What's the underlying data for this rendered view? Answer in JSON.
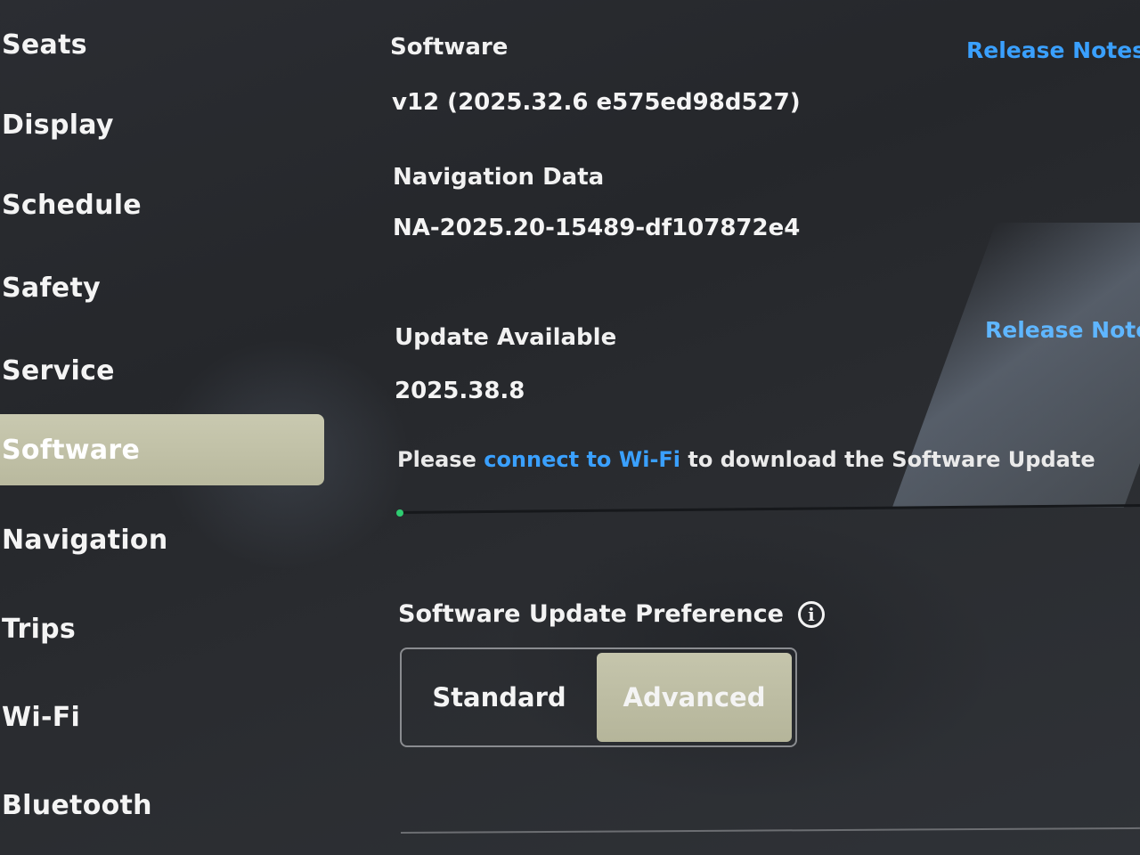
{
  "sidebar": {
    "items": [
      {
        "label": "Seats"
      },
      {
        "label": "Display"
      },
      {
        "label": "Schedule"
      },
      {
        "label": "Safety"
      },
      {
        "label": "Service"
      },
      {
        "label": "Software",
        "active": true
      },
      {
        "label": "Navigation"
      },
      {
        "label": "Trips"
      },
      {
        "label": "Wi-Fi"
      },
      {
        "label": "Bluetooth"
      }
    ]
  },
  "software": {
    "title": "Software",
    "version": "v12 (2025.32.6 e575ed98d527)",
    "release_notes_label": "Release Notes"
  },
  "navigation_data": {
    "title": "Navigation Data",
    "version": "NA-2025.20-15489-df107872e4"
  },
  "update": {
    "title": "Update Available",
    "version": "2025.38.8",
    "release_notes_label": "Release Notes",
    "message_prefix": "Please",
    "message_link": "connect to Wi-Fi",
    "message_suffix": "to download the Software Update"
  },
  "preference": {
    "title": "Software Update Preference",
    "info_symbol": "i",
    "options": [
      "Standard",
      "Advanced"
    ],
    "selected": "Advanced"
  },
  "colors": {
    "link": "#3aa0ff",
    "selected_bg": "#c0c0a6",
    "progress_dot": "#2ecc71"
  }
}
